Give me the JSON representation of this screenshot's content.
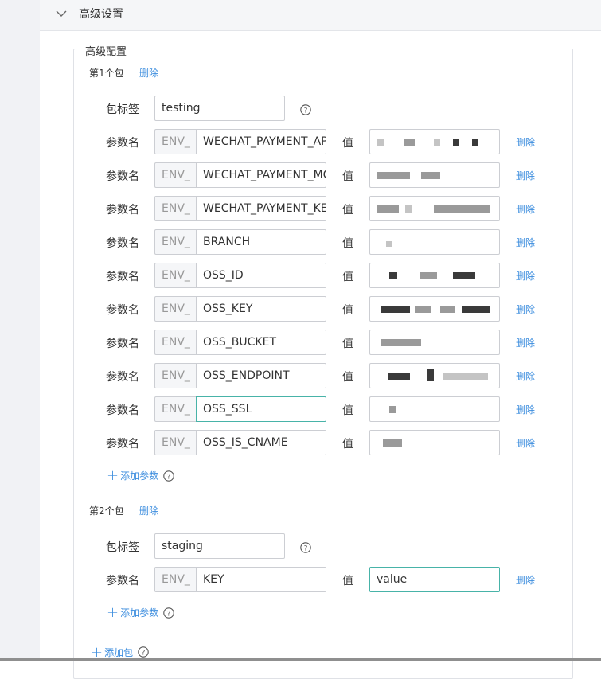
{
  "section": {
    "title": "高级设置"
  },
  "fieldset": {
    "legend": "高级配置"
  },
  "packages": [
    {
      "header": "第1个包",
      "delete_label": "删除",
      "tag_label": "包标签",
      "tag_value": "testing",
      "params": [
        {
          "label": "参数名",
          "prefix": "ENV_",
          "name": "WECHAT_PAYMENT_APP_ID",
          "value_label": "值",
          "value": "",
          "delete_label": "删除"
        },
        {
          "label": "参数名",
          "prefix": "ENV_",
          "name": "WECHAT_PAYMENT_MCH_ID",
          "value_label": "值",
          "value": "",
          "delete_label": "删除"
        },
        {
          "label": "参数名",
          "prefix": "ENV_",
          "name": "WECHAT_PAYMENT_KEY",
          "value_label": "值",
          "value": "",
          "delete_label": "删除"
        },
        {
          "label": "参数名",
          "prefix": "ENV_",
          "name": "BRANCH",
          "value_label": "值",
          "value": "",
          "delete_label": "删除"
        },
        {
          "label": "参数名",
          "prefix": "ENV_",
          "name": "OSS_ID",
          "value_label": "值",
          "value": "",
          "delete_label": "删除"
        },
        {
          "label": "参数名",
          "prefix": "ENV_",
          "name": "OSS_KEY",
          "value_label": "值",
          "value": "",
          "delete_label": "删除"
        },
        {
          "label": "参数名",
          "prefix": "ENV_",
          "name": "OSS_BUCKET",
          "value_label": "值",
          "value": "",
          "delete_label": "删除"
        },
        {
          "label": "参数名",
          "prefix": "ENV_",
          "name": "OSS_ENDPOINT",
          "value_label": "值",
          "value": "",
          "delete_label": "删除"
        },
        {
          "label": "参数名",
          "prefix": "ENV_",
          "name": "OSS_SSL",
          "value_label": "值",
          "value": "",
          "delete_label": "删除"
        },
        {
          "label": "参数名",
          "prefix": "ENV_",
          "name": "OSS_IS_CNAME",
          "value_label": "值",
          "value": "",
          "delete_label": "删除"
        }
      ],
      "add_param_label": "添加参数"
    },
    {
      "header": "第2个包",
      "delete_label": "删除",
      "tag_label": "包标签",
      "tag_value": "staging",
      "params": [
        {
          "label": "参数名",
          "prefix": "ENV_",
          "name": "KEY",
          "value_label": "值",
          "value": "value",
          "delete_label": "删除"
        }
      ],
      "add_param_label": "添加参数"
    }
  ],
  "add_package_label": "添加包",
  "colors": {
    "accent": "#3c8dde",
    "focus_border": "#48b3a8"
  }
}
